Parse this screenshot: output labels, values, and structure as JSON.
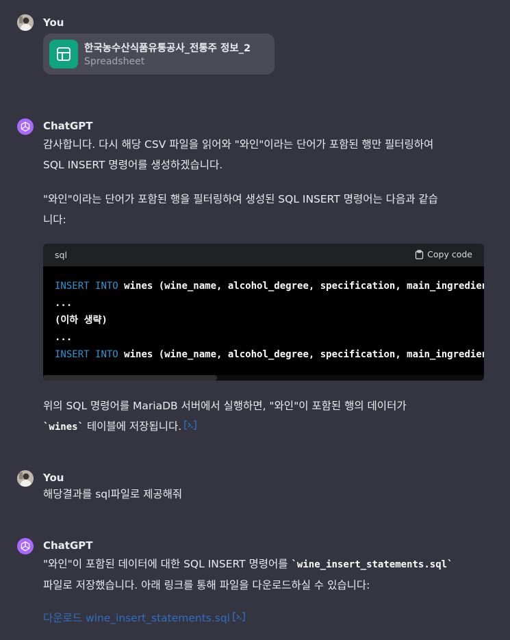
{
  "messages": [
    {
      "author": "You",
      "attachment": {
        "name": "한국농수산식품유통공사_전통주 정보_2",
        "type": "Spreadsheet"
      }
    },
    {
      "author": "ChatGPT",
      "para1_line1": "감사합니다. 다시 해당 CSV 파일을 읽어와 \"와인\"이라는 단어가 포함된 행만 필터링하여",
      "para1_line2": "SQL INSERT 명령어를 생성하겠습니다.",
      "para2_line1": "\"와인\"이라는 단어가 포함된 행을 필터링하여 생성된 SQL INSERT 명령어는 다음과 같습",
      "para2_line2": "니다:",
      "code": {
        "language": "sql",
        "copy_label": "Copy code",
        "kw1": "INSERT",
        "kw2": "INTO",
        "line1_rest": " wines (wine_name, alcohol_degree, specification, main_ingredients) VALUES",
        "line2": "...",
        "line3": "(이하 생략)",
        "line4": "...",
        "line5_rest": " wines (wine_name, alcohol_degree, specification, main_ingredients) VALUES"
      },
      "para3_line1": "위의 SQL 명령어를 MariaDB 서버에서 실행하면, \"와인\"이 포함된 행의 데이터가",
      "para3_code": "`wines`",
      "para3_line2_rest": " 테이블에 저장됩니다."
    },
    {
      "author": "You",
      "text": "해당결과를 sql파일로 제공해줘"
    },
    {
      "author": "ChatGPT",
      "line1_pre": "\"와인\"이 포함된 데이터에 대한 SQL INSERT 명령어를 ",
      "line1_code": "`wine_insert_statements.sql`",
      "line2": "파일로 저장했습니다. 아래 링크를 통해 파일을 다운로드하실 수 있습니다:",
      "link": "다운로드 wine_insert_statements.sql"
    }
  ],
  "colors": {
    "background": "#343541",
    "gpt_avatar": "#ab68ff",
    "spreadsheet_icon": "#10a37f",
    "keyword": "#2e95d3",
    "link": "#2e6fc1"
  }
}
